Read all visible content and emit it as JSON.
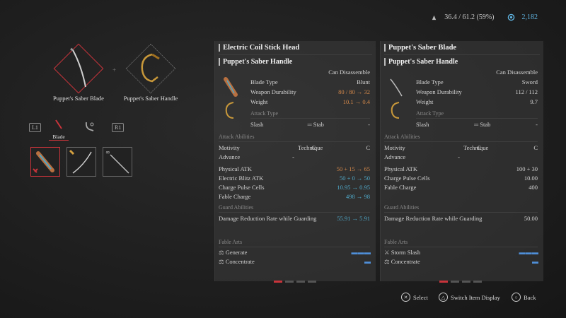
{
  "status": {
    "weight": "36.4 / 61.2 (59%)",
    "ergo": "2,182"
  },
  "assembly": {
    "blade_name": "Puppet's Saber Blade",
    "handle_name": "Puppet's Saber Handle",
    "plus": "+"
  },
  "tabs": {
    "l1": "L1",
    "r1": "R1",
    "active_label": "Blade"
  },
  "left_panel": {
    "title": "Electric Coil Stick Head",
    "sub_title": "Puppet's Saber Handle",
    "can_disassemble": "Can Disassemble",
    "blade_type_label": "Blade Type",
    "blade_type": "Blunt",
    "durability_label": "Weapon Durability",
    "durability": "80 / 80 → 32",
    "weight_label": "Weight",
    "weight": "10.1 → 0.4",
    "attack_type_header": "Attack Type",
    "slash": "Slash",
    "stab": "Stab",
    "attack_dash": "-",
    "attack_abilities_header": "Attack Abilities",
    "motivity_label": "Motivity",
    "motivity": "C",
    "technique_label": "Technique",
    "technique": "C",
    "advance_label": "Advance",
    "advance": "-",
    "phys_label": "Physical ATK",
    "phys": "50 + 15 → 65",
    "elec_label": "Electric Blitz ATK",
    "elec": "50 + 0 → 50",
    "cells_label": "Charge Pulse Cells",
    "cells": "10.95 → 0.95",
    "fable_label": "Fable Charge",
    "fable": "498 → 98",
    "guard_header": "Guard Abilities",
    "dmg_red_label": "Damage Reduction Rate while Guarding",
    "dmg_red": "55.91 → 5.91",
    "fable_arts_header": "Fable Arts",
    "art1": "Generate",
    "art2": "Concentrate"
  },
  "right_panel": {
    "title": "Puppet's Saber Blade",
    "sub_title": "Puppet's Saber Handle",
    "can_disassemble": "Can Disassemble",
    "blade_type_label": "Blade Type",
    "blade_type": "Sword",
    "durability_label": "Weapon Durability",
    "durability": "112 / 112",
    "weight_label": "Weight",
    "weight": "9.7",
    "attack_type_header": "Attack Type",
    "slash": "Slash",
    "stab": "Stab",
    "attack_dash": "-",
    "attack_abilities_header": "Attack Abilities",
    "motivity_label": "Motivity",
    "motivity": "C",
    "technique_label": "Technique",
    "technique": "C",
    "advance_label": "Advance",
    "advance": "-",
    "phys_label": "Physical ATK",
    "phys": "100 + 30",
    "cells_label": "Charge Pulse Cells",
    "cells": "10.00",
    "fable_label": "Fable Charge",
    "fable": "400",
    "guard_header": "Guard Abilities",
    "dmg_red_label": "Damage Reduction Rate while Guarding",
    "dmg_red": "50.00",
    "fable_arts_header": "Fable Arts",
    "art1": "Storm Slash",
    "art2": "Concentrate"
  },
  "hints": {
    "select": "Select",
    "switch": "Switch Item Display",
    "back": "Back"
  },
  "colors": {
    "accent": "#c9343b",
    "orange": "#d4884a",
    "blue": "#4fa8c8"
  }
}
